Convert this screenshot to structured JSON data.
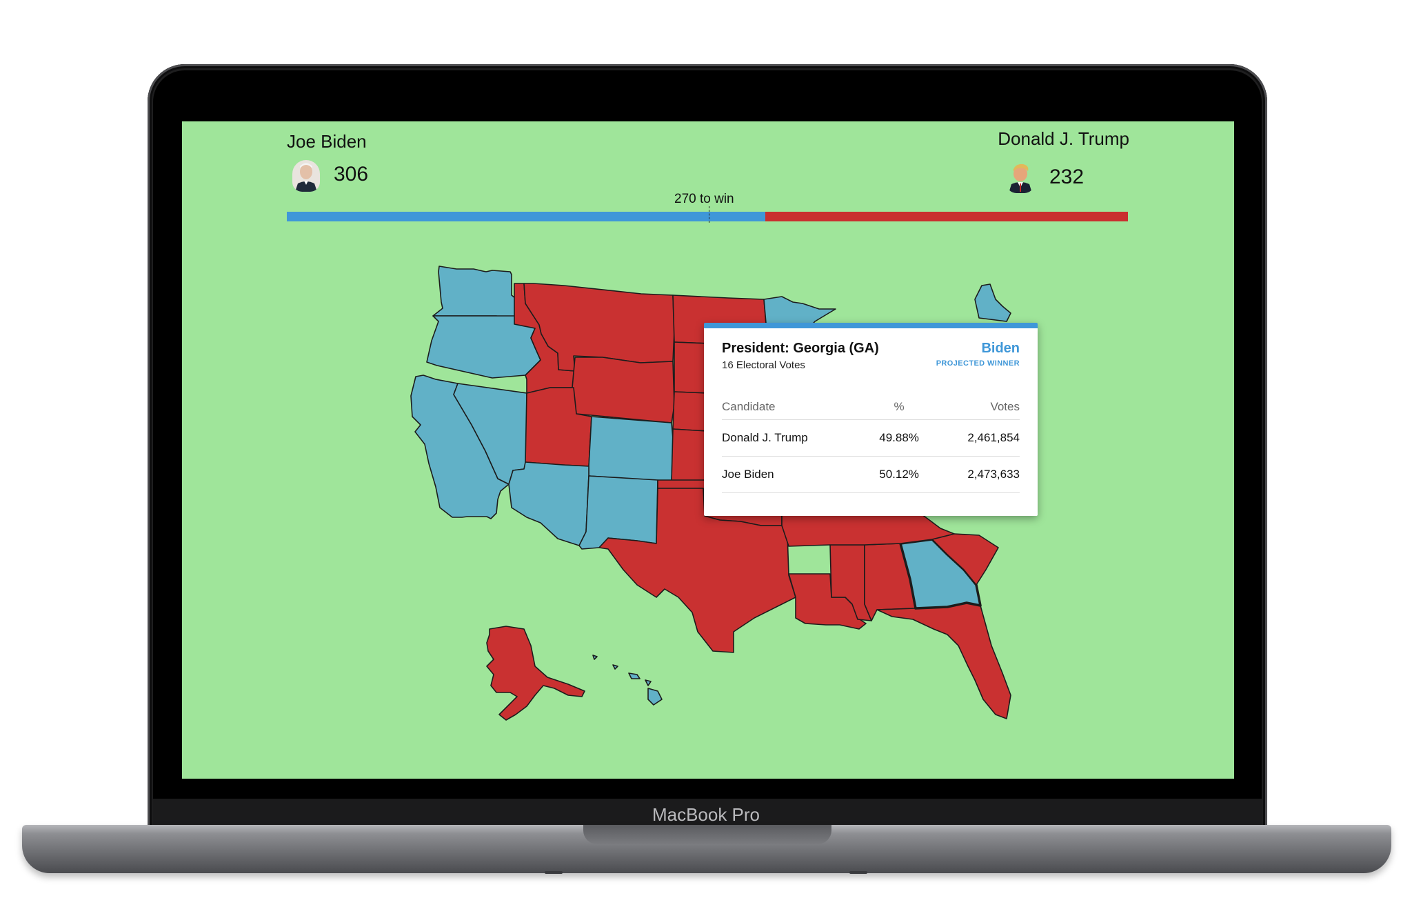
{
  "device": {
    "brand": "MacBook Pro"
  },
  "header": {
    "left_candidate": {
      "name": "Joe Biden",
      "electoral_votes": "306",
      "color": "#3f97d8"
    },
    "right_candidate": {
      "name": "Donald J. Trump",
      "electoral_votes": "232",
      "color": "#c92f2f"
    },
    "threshold_label": "270 to win",
    "total_electoral_votes": 538,
    "threshold": 270
  },
  "map": {
    "background": "#9fe59a",
    "party_colors": {
      "biden": "#61b1c7",
      "trump": "#c93131"
    },
    "highlighted_state": "GA"
  },
  "tooltip": {
    "title": "President: Georgia (GA)",
    "subtitle": "16 Electoral Votes",
    "winner": "Biden",
    "winner_label": "PROJECTED WINNER",
    "columns": [
      "Candidate",
      "%",
      "Votes"
    ],
    "rows": [
      {
        "candidate": "Donald J. Trump",
        "pct": "49.88%",
        "votes": "2,461,854"
      },
      {
        "candidate": "Joe Biden",
        "pct": "50.12%",
        "votes": "2,473,633"
      }
    ]
  }
}
